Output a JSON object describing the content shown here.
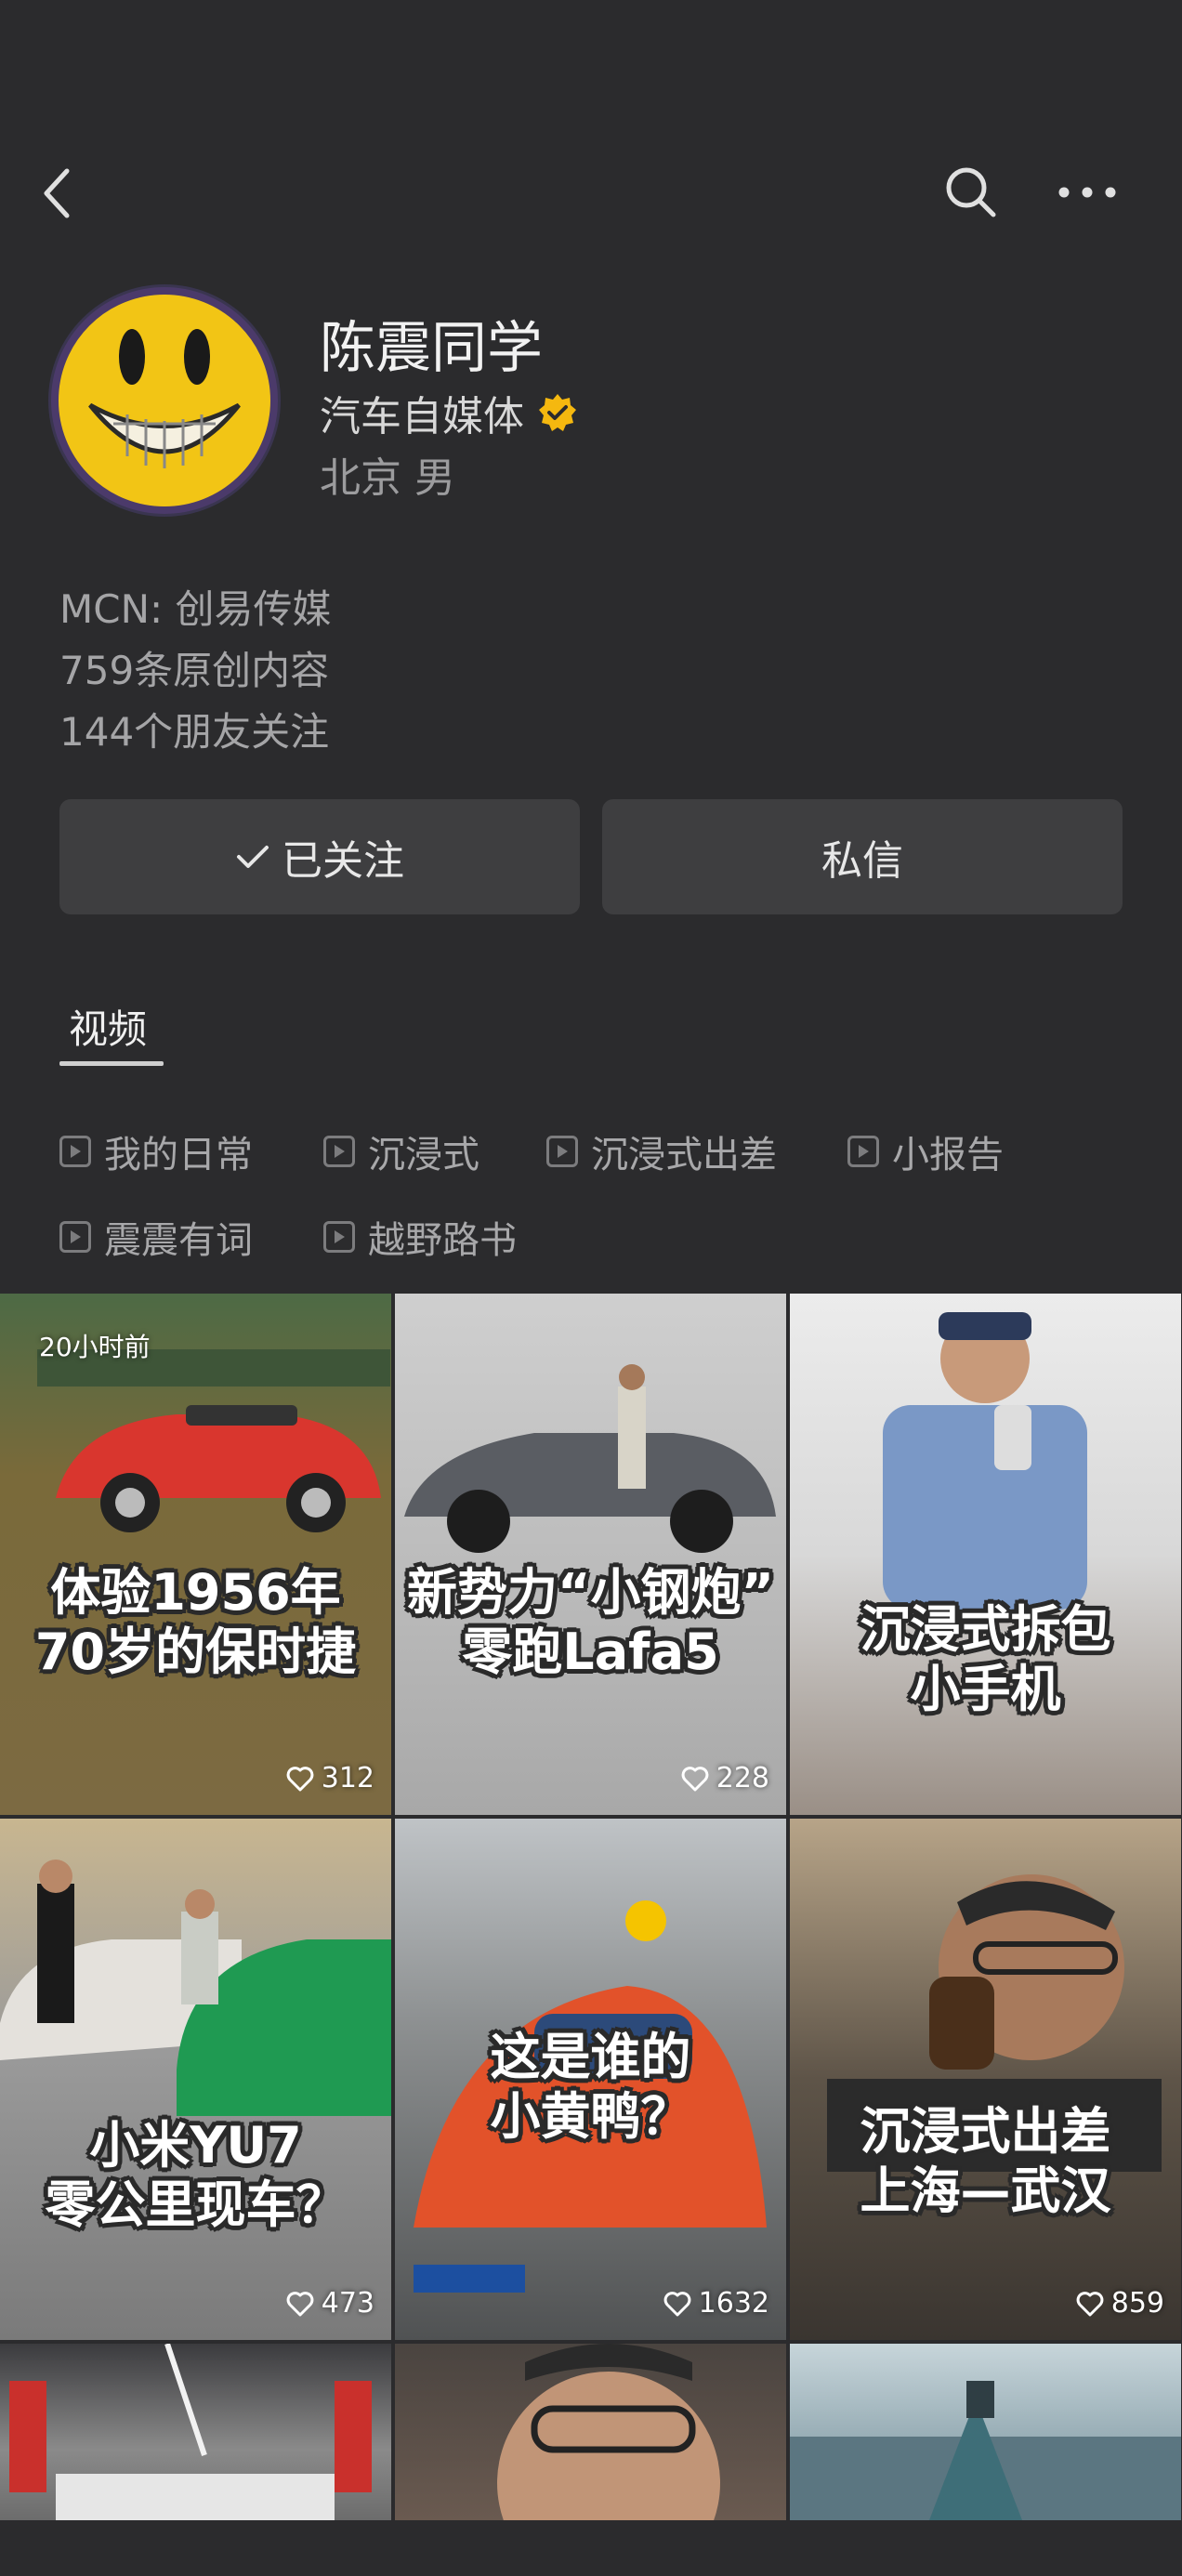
{
  "nav": {
    "back_icon": "chevron-left-icon",
    "search_icon": "search-icon",
    "more_icon": "more-horizontal-icon"
  },
  "profile": {
    "name": "陈震同学",
    "category": "汽车自媒体",
    "verified_icon": "verified-badge-icon",
    "location_gender": "北京 男",
    "mcn": "MCN: 创易传媒",
    "original_count": "759条原创内容",
    "friends_following": "144个朋友关注"
  },
  "actions": {
    "follow_label": "已关注",
    "message_label": "私信"
  },
  "tabs": {
    "videos": "视频"
  },
  "playlists": [
    {
      "label": "我的日常"
    },
    {
      "label": "沉浸式"
    },
    {
      "label": "沉浸式出差"
    },
    {
      "label": "小报告"
    },
    {
      "label": "震震有词"
    },
    {
      "label": "越野路书"
    }
  ],
  "videos": [
    {
      "caption_line1": "体验1956年",
      "caption_line2": "70岁的保时捷",
      "likes": "312",
      "stamp": "20小时前"
    },
    {
      "caption_line1": "新势力“小钢炮”",
      "caption_line2": "零跑Lafa5",
      "likes": "228",
      "stamp": ""
    },
    {
      "caption_line1": "沉浸式拆包",
      "caption_line2": "小手机",
      "likes": "",
      "stamp": ""
    },
    {
      "caption_line1": "小米YU7",
      "caption_line2": "零公里现车？",
      "likes": "473",
      "stamp": ""
    },
    {
      "caption_line1": "这是谁的",
      "caption_line2": "小黄鸭？",
      "likes": "1632",
      "stamp": ""
    },
    {
      "caption_line1": "沉浸式出差",
      "caption_line2": "上海—武汉",
      "likes": "859",
      "stamp": ""
    }
  ],
  "colors": {
    "background": "#2b2b2d",
    "button_bg": "#3e3e40",
    "verified": "#f5b80f"
  }
}
